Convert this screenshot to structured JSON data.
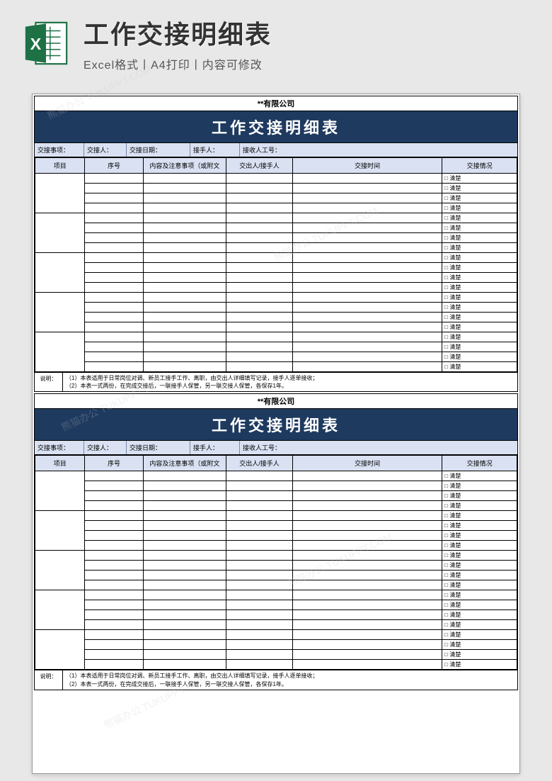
{
  "header": {
    "title": "工作交接明细表",
    "subtitle": "Excel格式丨A4打印丨内容可修改"
  },
  "form": {
    "company": "**有限公司",
    "banner": "工作交接明细表",
    "info_labels": {
      "item": "交接事项：",
      "handover": "交接人：",
      "date": "交接日期：",
      "receiver": "接手人：",
      "receiver_id": "接收人工号："
    },
    "columns": {
      "project": "项目",
      "seq": "序号",
      "content": "内容及注意事项（或附文",
      "person": "交出人/接手人",
      "time": "交接时间",
      "status": "交接情况"
    },
    "status_option": "清楚",
    "row_count": 20,
    "merge_groups": 5,
    "notes_label": "说明：",
    "note1": "（1）本表适用于日常岗位对调、新员工接手工作、离职，由交出人详细填写记录，接手人逐单接收；",
    "note2": "（2）本表一式两份，在完成交接后，一联接手人保管，另一联交接人保管，各保存1年。"
  },
  "watermark": "熊猫办公 TUKUPPT.COM"
}
